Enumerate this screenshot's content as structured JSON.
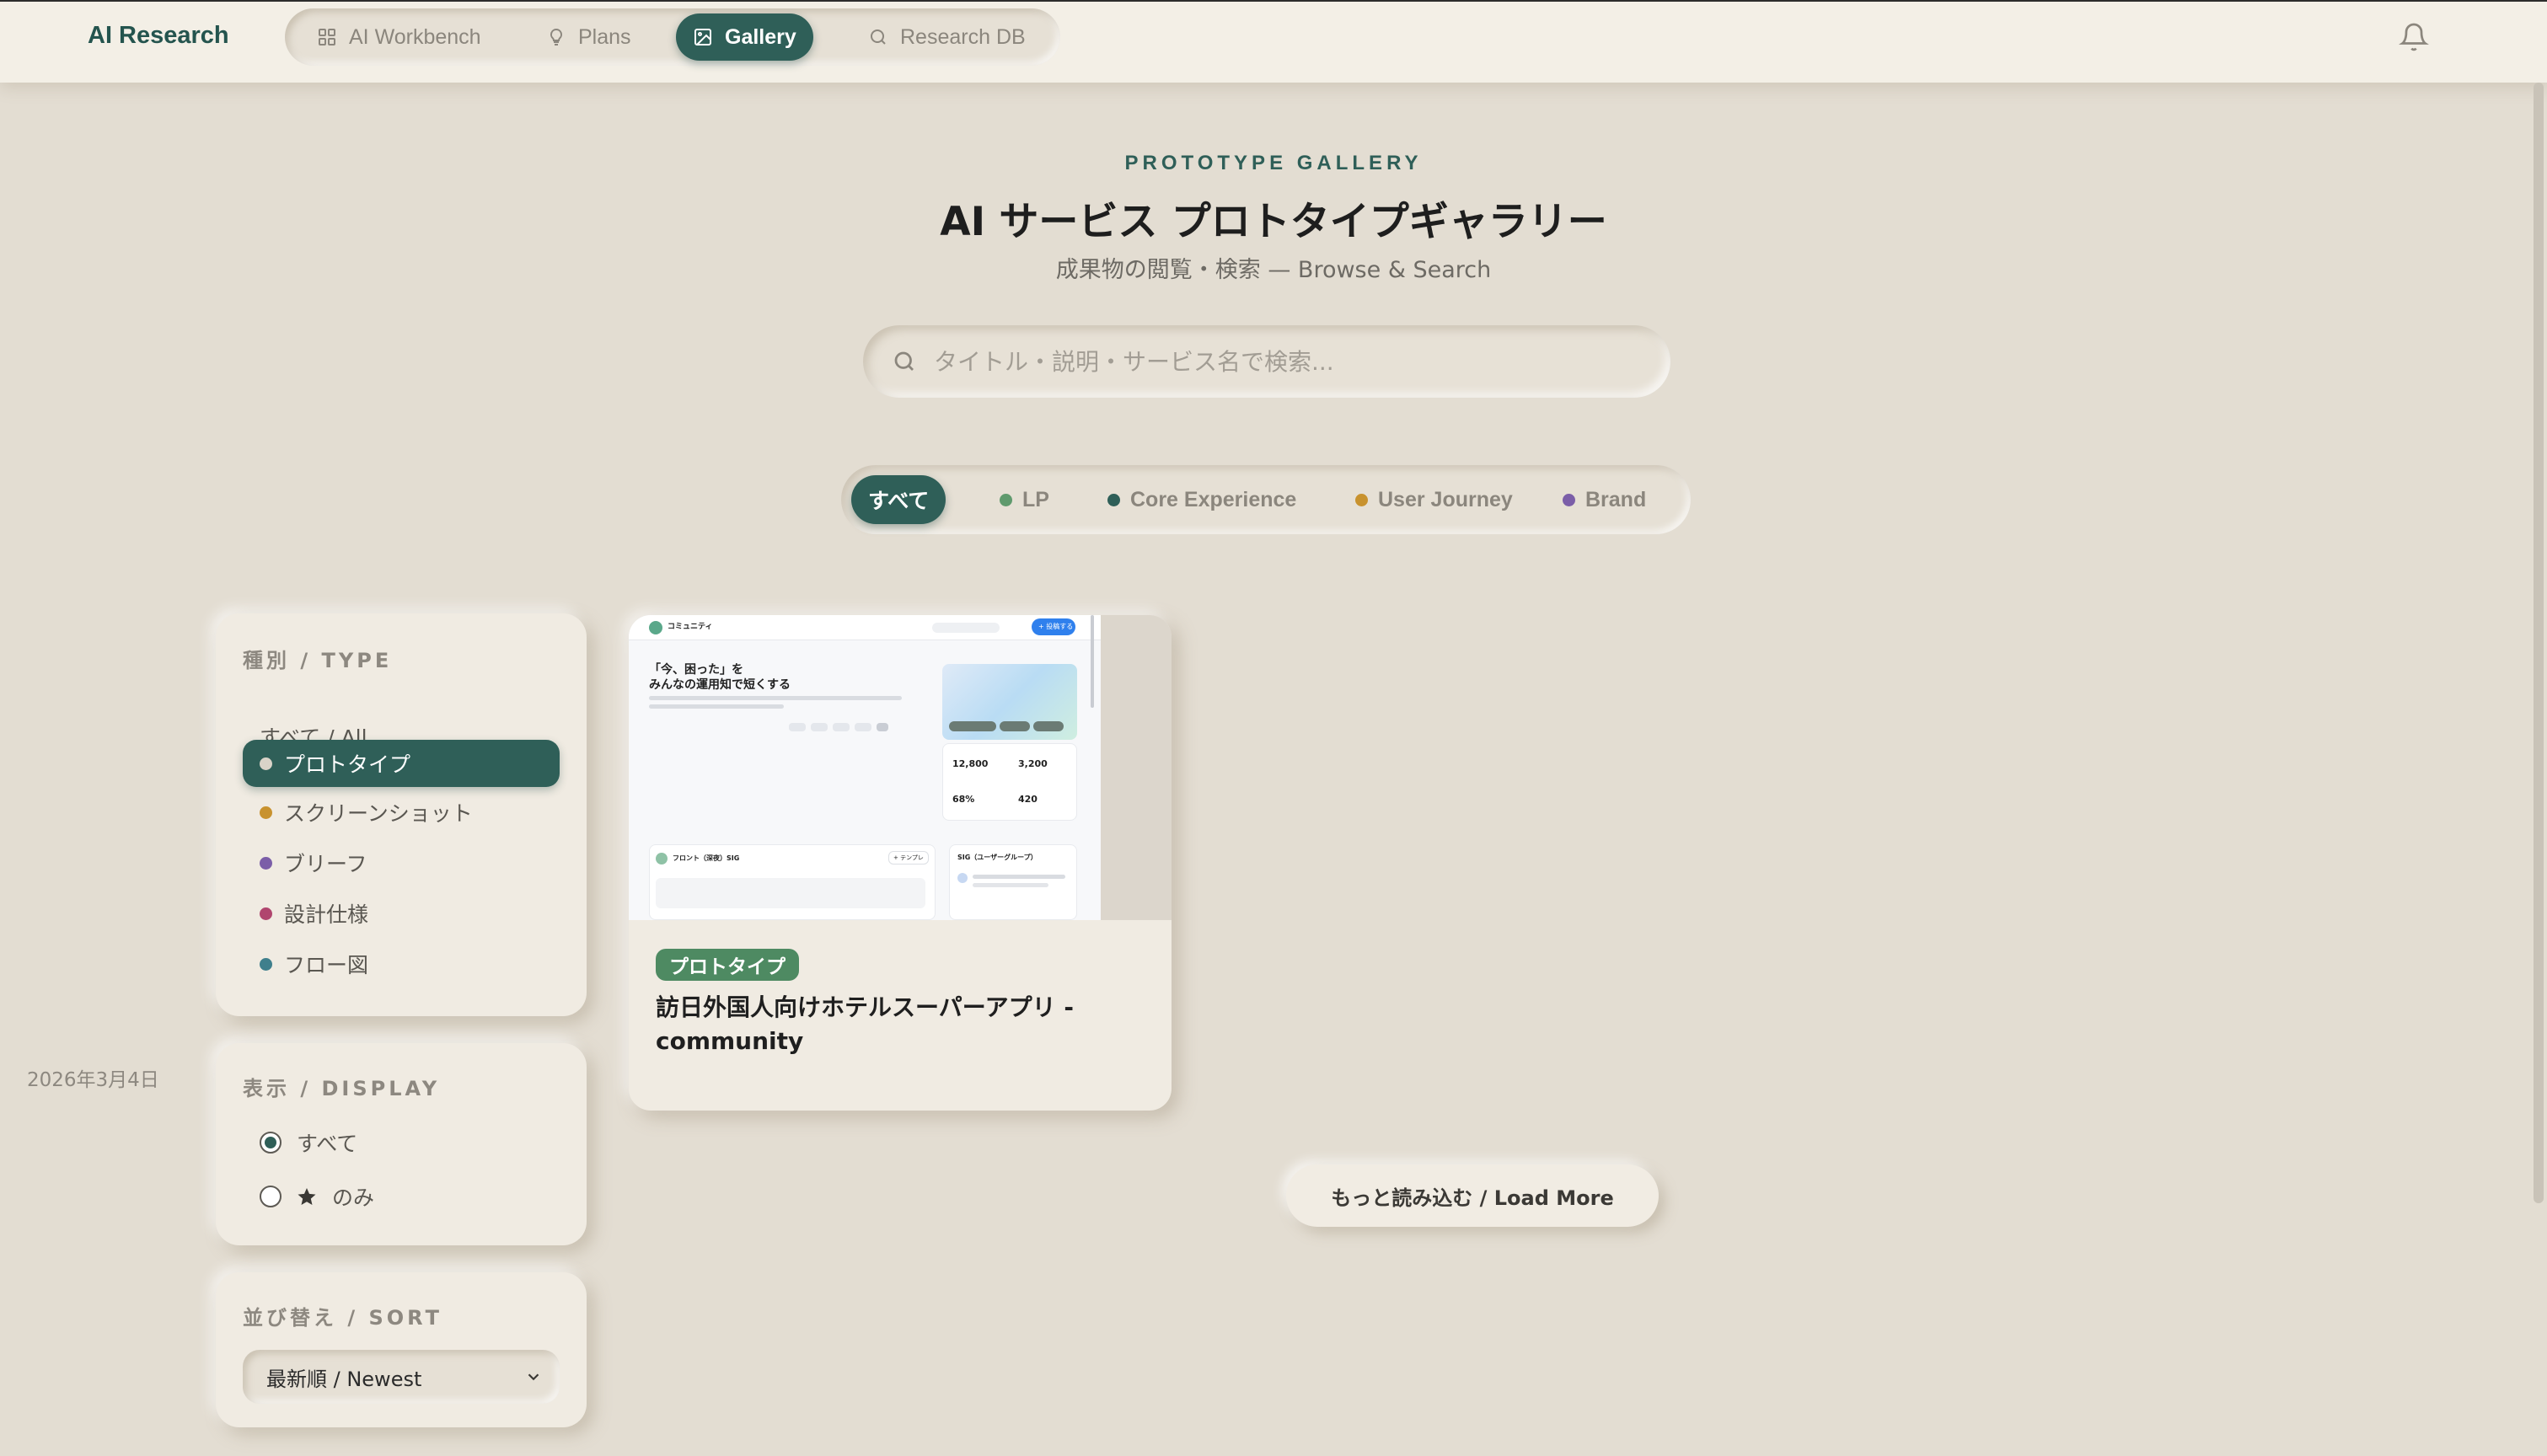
{
  "app": {
    "brand": "AI Research"
  },
  "nav": {
    "items": [
      {
        "label": "AI Workbench",
        "icon": "grid-icon",
        "active": false
      },
      {
        "label": "Plans",
        "icon": "lightbulb-icon",
        "active": false
      },
      {
        "label": "Gallery",
        "icon": "image-icon",
        "active": true
      },
      {
        "label": "Research DB",
        "icon": "search-icon",
        "active": false
      }
    ],
    "notification_icon": "bell-icon"
  },
  "hero": {
    "eyebrow": "PROTOTYPE GALLERY",
    "title": "AI サービス プロトタイプギャラリー",
    "subtitle": "成果物の閲覧・検索 — Browse & Search"
  },
  "search": {
    "placeholder": "タイトル・説明・サービス名で検索...",
    "value": ""
  },
  "categories": [
    {
      "label": "すべて",
      "active": true
    },
    {
      "label": "LP",
      "color": "#5f9a6d"
    },
    {
      "label": "Core Experience",
      "color": "#2f5f58"
    },
    {
      "label": "User Journey",
      "color": "#c8922e"
    },
    {
      "label": "Brand",
      "color": "#7b5ea8"
    }
  ],
  "filters": {
    "type": {
      "title": "種別 / TYPE",
      "items": [
        {
          "label": "すべて / All",
          "active": false
        },
        {
          "label": "プロトタイプ",
          "color": "#e3ddd2",
          "active": true
        },
        {
          "label": "スクリーンショット",
          "color": "#c8922e"
        },
        {
          "label": "ブリーフ",
          "color": "#7b5ea8"
        },
        {
          "label": "設計仕様",
          "color": "#b0456e"
        },
        {
          "label": "フロー図",
          "color": "#3f7f8c"
        }
      ]
    },
    "display": {
      "title": "表示 / DISPLAY",
      "options": [
        {
          "label": "すべて",
          "checked": true
        },
        {
          "label": "のみ",
          "icon": "star-icon",
          "checked": false
        }
      ]
    },
    "sort": {
      "title": "並び替え / SORT",
      "selected": "最新順 / Newest"
    }
  },
  "cards": [
    {
      "badge": "プロトタイプ",
      "title": "訪日外国人向けホテルスーパーアプリ - community",
      "date": "2026年3月4日",
      "preview": {
        "logo": "コミュニティ",
        "heading_line1": "「今、困った」を",
        "heading_line2": "みんなの運用知で短くする",
        "stats": [
          "12,800",
          "3,200",
          "68%",
          "420"
        ],
        "panel_left": "フロント（深夜）SIG",
        "panel_right": "SIG（ユーザーグループ）",
        "cta": "+ 投稿する",
        "chip_label": "+ テンプレ"
      }
    }
  ],
  "actions": {
    "load_more": "もっと読み込む / Load More"
  }
}
